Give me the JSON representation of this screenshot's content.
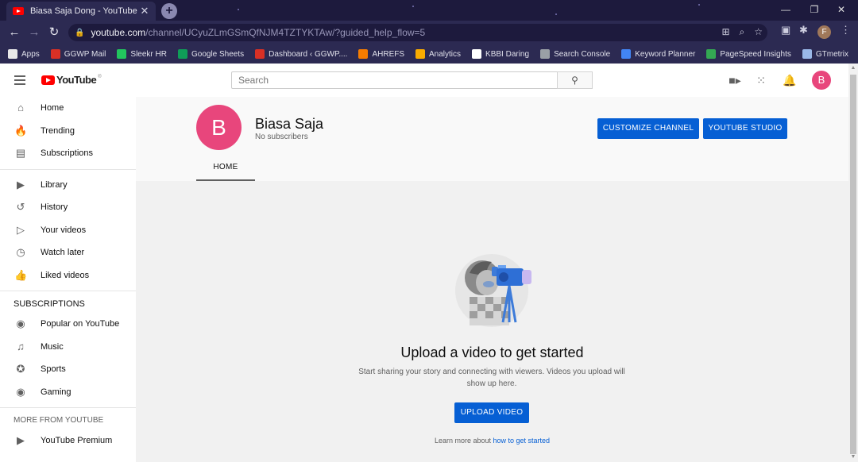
{
  "browser": {
    "tab_title": "Biasa Saja Dong - YouTube",
    "tab_close": "✕",
    "new_tab": "+",
    "url_host": "youtube.com",
    "url_path": "/channel/UCyuZLmGSmQfNJM4TZTYKTAw/?guided_help_flow=5",
    "profile_initial": "F",
    "bookmarks": [
      {
        "label": "Apps",
        "color": "#e8e8e8"
      },
      {
        "label": "GGWP Mail",
        "color": "#d93025"
      },
      {
        "label": "Sleekr HR",
        "color": "#22c55e"
      },
      {
        "label": "Google Sheets",
        "color": "#0f9d58"
      },
      {
        "label": "Dashboard ‹ GGWP....",
        "color": "#d93025"
      },
      {
        "label": "AHREFS",
        "color": "#f57c00"
      },
      {
        "label": "Analytics",
        "color": "#f9ab00"
      },
      {
        "label": "KBBI Daring",
        "color": "#ffffff"
      },
      {
        "label": "Search Console",
        "color": "#9aa0a6"
      },
      {
        "label": "Keyword Planner",
        "color": "#4285f4"
      },
      {
        "label": "PageSpeed Insights",
        "color": "#34a853"
      },
      {
        "label": "GTmetrix",
        "color": "#9ab8e8"
      }
    ]
  },
  "masthead": {
    "logo_text": "YouTube",
    "logo_reg": "®",
    "search_placeholder": "Search",
    "avatar_initial": "B"
  },
  "sidebar": {
    "main": [
      {
        "label": "Home",
        "icon": "home-icon",
        "glyph": "⌂"
      },
      {
        "label": "Trending",
        "icon": "trending-icon",
        "glyph": "🔥"
      },
      {
        "label": "Subscriptions",
        "icon": "subscriptions-icon",
        "glyph": "▤"
      }
    ],
    "library": [
      {
        "label": "Library",
        "icon": "library-icon",
        "glyph": "▶"
      },
      {
        "label": "History",
        "icon": "history-icon",
        "glyph": "↺"
      },
      {
        "label": "Your videos",
        "icon": "your-videos-icon",
        "glyph": "▷"
      },
      {
        "label": "Watch later",
        "icon": "watch-later-icon",
        "glyph": "◷"
      },
      {
        "label": "Liked videos",
        "icon": "liked-videos-icon",
        "glyph": "👍"
      }
    ],
    "subscriptions_heading": "SUBSCRIPTIONS",
    "subscriptions": [
      {
        "label": "Popular on YouTube",
        "icon": "popular-icon",
        "glyph": "◉"
      },
      {
        "label": "Music",
        "icon": "music-icon",
        "glyph": "♫"
      },
      {
        "label": "Sports",
        "icon": "sports-icon",
        "glyph": "✪"
      },
      {
        "label": "Gaming",
        "icon": "gaming-icon",
        "glyph": "◉"
      }
    ],
    "more_heading": "MORE FROM YOUTUBE",
    "more": [
      {
        "label": "YouTube Premium",
        "icon": "youtube-premium-icon",
        "glyph": "▶"
      }
    ]
  },
  "channel": {
    "avatar_initial": "B",
    "name": "Biasa Saja",
    "subscribers": "No subscribers",
    "customize_label": "CUSTOMIZE CHANNEL",
    "studio_label": "YOUTUBE STUDIO",
    "tab_home": "HOME"
  },
  "empty_state": {
    "title": "Upload a video to get started",
    "description": "Start sharing your story and connecting with viewers. Videos you upload will show up here.",
    "upload_label": "UPLOAD VIDEO",
    "learn_prefix": "Learn more about",
    "learn_link": "how to get started"
  },
  "colors": {
    "accent_blue": "#065fd4",
    "avatar_pink": "#e8467c",
    "youtube_red": "#ff0000"
  }
}
